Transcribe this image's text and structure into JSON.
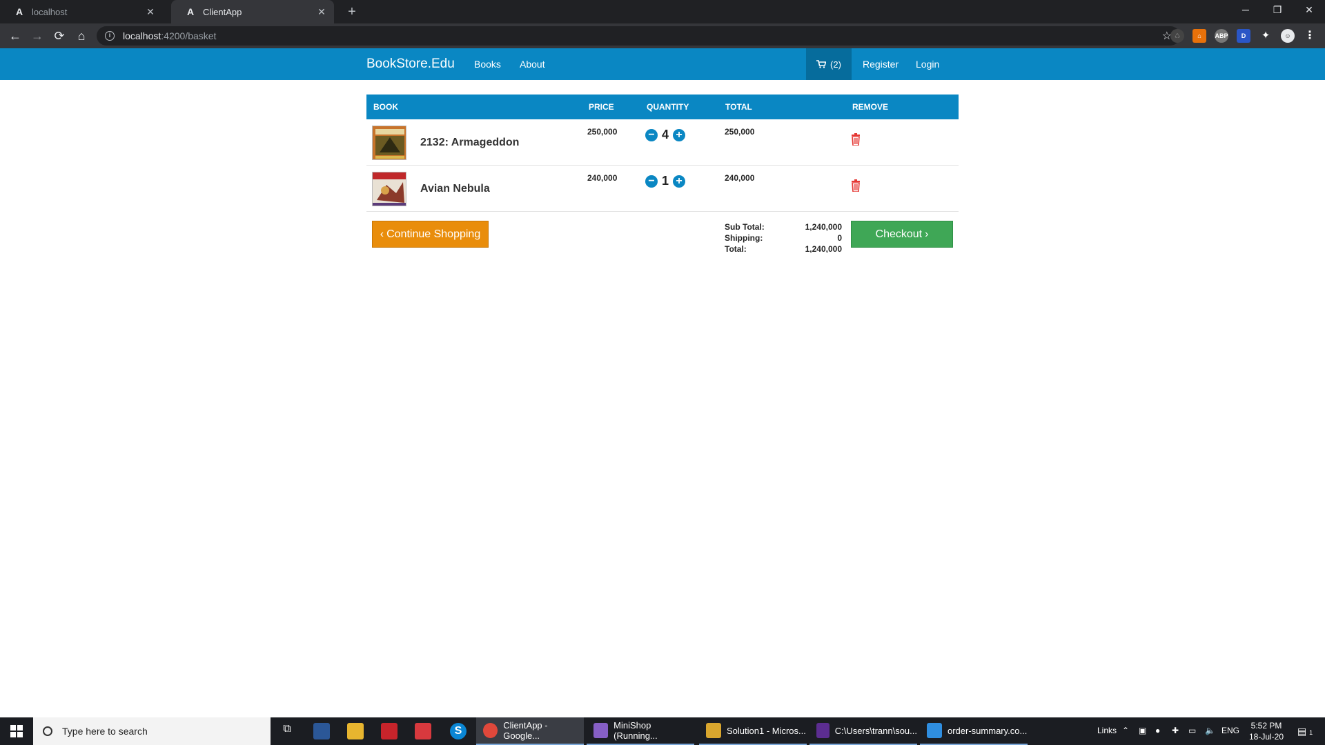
{
  "browser": {
    "tabs": [
      {
        "title": "localhost",
        "active": false
      },
      {
        "title": "ClientApp",
        "active": true
      }
    ],
    "url_host": "localhost",
    "url_path": ":4200/basket"
  },
  "navbar": {
    "brand": "BookStore.Edu",
    "links": [
      "Books",
      "About"
    ],
    "cart_count": "(2)",
    "right_links": [
      "Register",
      "Login"
    ]
  },
  "basket": {
    "headers": {
      "book": "BOOK",
      "price": "PRICE",
      "quantity": "QUANTITY",
      "total": "TOTAL",
      "remove": "REMOVE"
    },
    "items": [
      {
        "title": "2132: Armageddon",
        "price": "250,000",
        "quantity": "4",
        "total": "250,000"
      },
      {
        "title": "Avian Nebula",
        "price": "240,000",
        "quantity": "1",
        "total": "240,000"
      }
    ],
    "continue_label": "Continue Shopping",
    "checkout_label": "Checkout",
    "summary": {
      "subtotal_label": "Sub Total:",
      "subtotal": "1,240,000",
      "shipping_label": "Shipping:",
      "shipping": "0",
      "total_label": "Total:",
      "total": "1,240,000"
    }
  },
  "taskbar": {
    "search_placeholder": "Type here to search",
    "apps": [
      {
        "label": "ClientApp - Google...",
        "color": "#e0483b"
      },
      {
        "label": "MiniShop (Running...",
        "color": "#865fc5"
      },
      {
        "label": "Solution1 - Micros...",
        "color": "#d9a62e"
      },
      {
        "label": "C:\\Users\\trann\\sou...",
        "color": "#5c2d91"
      },
      {
        "label": "order-summary.co...",
        "color": "#2f8ee0"
      }
    ],
    "tray_links": "Links",
    "language": "ENG",
    "time": "5:52 PM",
    "date": "18-Jul-20",
    "notification_count": "1"
  }
}
